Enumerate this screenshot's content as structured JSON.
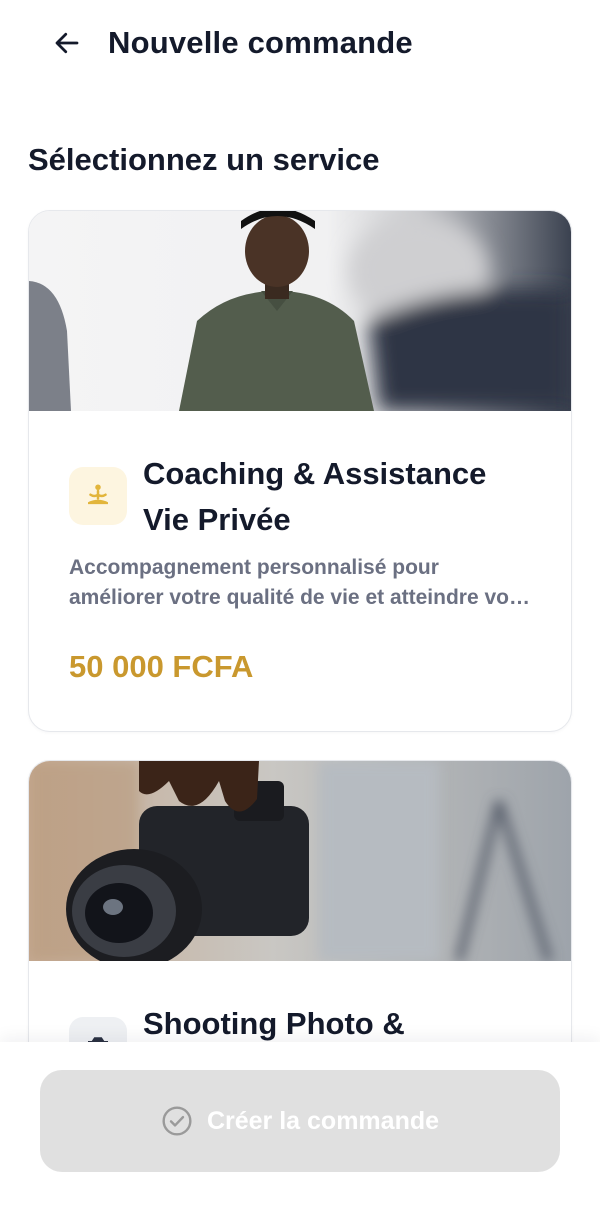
{
  "header": {
    "title": "Nouvelle commande",
    "back_icon": "arrow-left-icon"
  },
  "section": {
    "title": "Sélectionnez un service"
  },
  "services": [
    {
      "title_line1": "Coaching & Assistance",
      "title_line2": "Vie Privée",
      "description": "Accompagnement personnalisé pour améliorer votre qualité de vie et atteindre vos objectifs",
      "price": "50 000 FCFA",
      "icon": "meditation-icon",
      "icon_bg": "#fdf5e0",
      "icon_color": "#e2b53b"
    },
    {
      "title_line1": "Shooting Photo &",
      "icon": "camera-icon",
      "icon_bg": "#eef0f3",
      "icon_color": "#2b3142"
    }
  ],
  "footer": {
    "create_label": "Créer la commande",
    "create_icon": "check-circle-icon"
  },
  "colors": {
    "accent_price": "#c9982e",
    "button_disabled_bg": "#e0e0e0",
    "text_primary": "#141a2b",
    "text_secondary": "#6b7082"
  }
}
